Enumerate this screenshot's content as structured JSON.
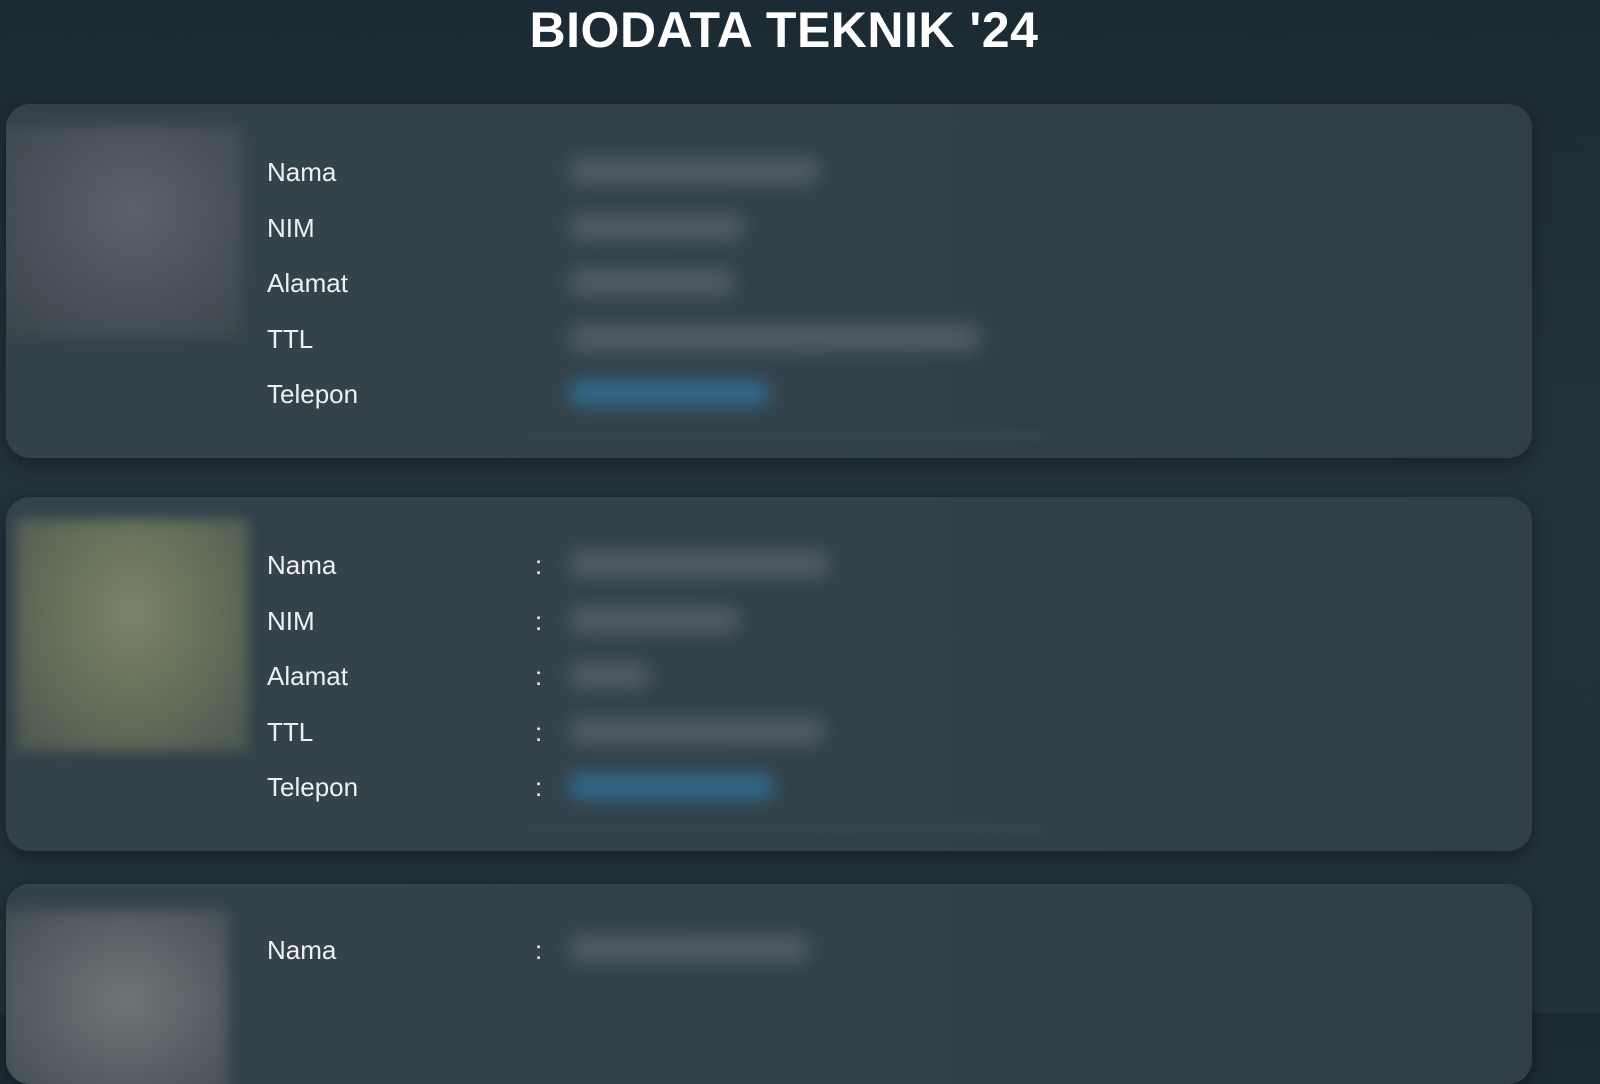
{
  "page": {
    "title": "BIODATA TEKNIK '24"
  },
  "colors": {
    "background": "#1c2a33",
    "card": "#34434b",
    "text": "#f2f4f5",
    "phone_link": "#2f6f93"
  },
  "cards": [
    {
      "show_colon": false,
      "fields": [
        {
          "label": "Nama"
        },
        {
          "label": "NIM"
        },
        {
          "label": "Alamat"
        },
        {
          "label": "TTL"
        },
        {
          "label": "Telepon"
        }
      ]
    },
    {
      "show_colon": true,
      "colon": ":",
      "fields": [
        {
          "label": "Nama"
        },
        {
          "label": "NIM"
        },
        {
          "label": "Alamat"
        },
        {
          "label": "TTL"
        },
        {
          "label": "Telepon"
        }
      ]
    },
    {
      "show_colon": true,
      "colon": ":",
      "fields": [
        {
          "label": "Nama"
        }
      ]
    }
  ]
}
